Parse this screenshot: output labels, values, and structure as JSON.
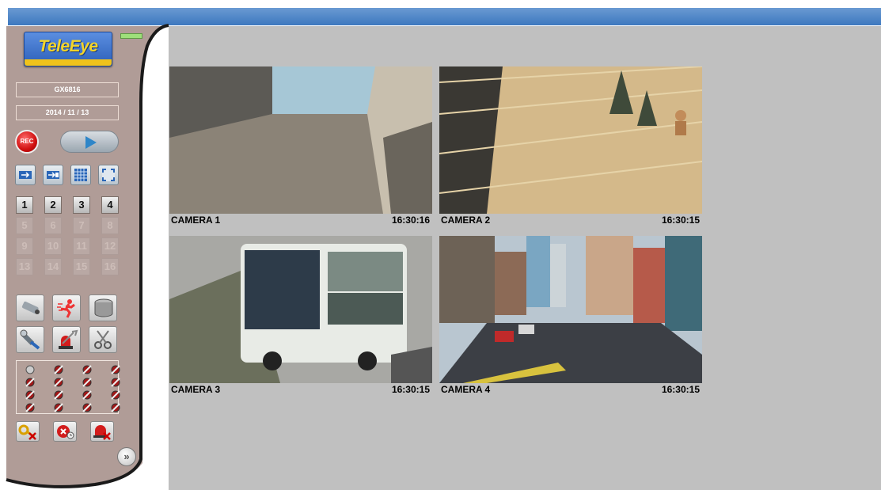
{
  "brand": {
    "logo_text": "TeleEye"
  },
  "device": {
    "model": "GX6816",
    "date": "2014 / 11 / 13"
  },
  "controls": {
    "rec_label": "REC",
    "more_label": "»"
  },
  "camera_buttons": {
    "enabled": [
      "1",
      "2",
      "3",
      "4"
    ],
    "disabled": [
      "5",
      "6",
      "7",
      "8",
      "9",
      "10",
      "11",
      "12",
      "13",
      "14",
      "15",
      "16"
    ]
  },
  "cameras": [
    {
      "name": "CAMERA 1",
      "time": "16:30:16"
    },
    {
      "name": "CAMERA 2",
      "time": "16:30:15"
    },
    {
      "name": "CAMERA 3",
      "time": "16:30:15"
    },
    {
      "name": "CAMERA 4",
      "time": "16:30:15"
    }
  ],
  "colors": {
    "panel": "#b09c97",
    "top_bar": "#3d78bf",
    "viewer_bg": "#c0c0c0",
    "logo_text": "#f3d42a"
  },
  "icons": [
    "play-icon",
    "single-view-icon",
    "quad-view-icon",
    "grid-view-icon",
    "fullscreen-icon",
    "camera-icon",
    "motion-alarm-icon",
    "storage-icon",
    "tool-icon",
    "siren-icon",
    "scissors-icon",
    "key-icon",
    "clock-icon",
    "alarm-clear-icon"
  ]
}
